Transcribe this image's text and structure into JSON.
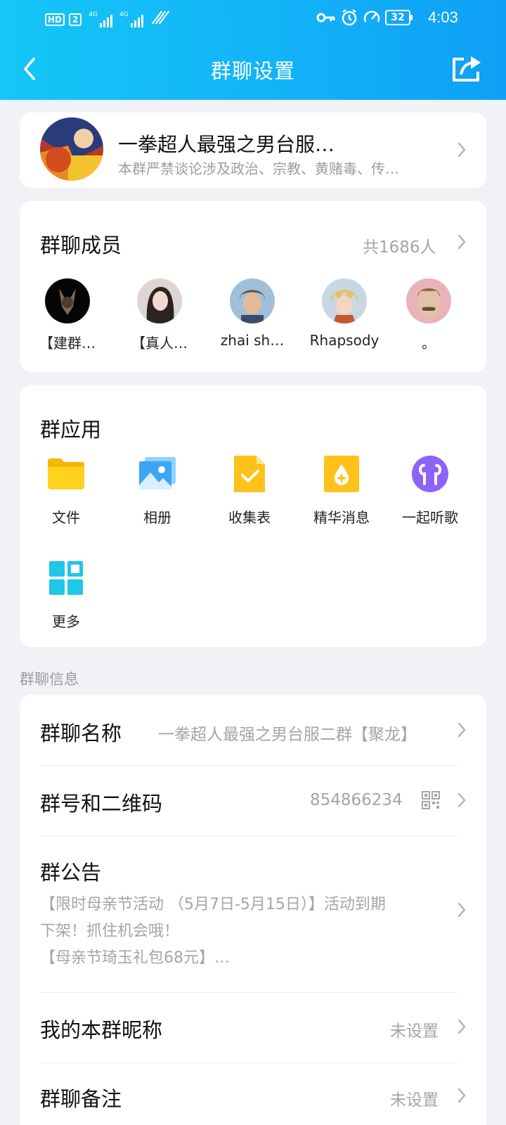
{
  "status_bar": {
    "hd_label": "HD",
    "sim_label": "2",
    "signal_label_1": "4G",
    "signal_label_2": "4G",
    "battery": "32",
    "time": "4:03"
  },
  "header": {
    "title": "群聊设置"
  },
  "group": {
    "name": "一拳超人最强之男台服…",
    "description": "本群严禁谈论涉及政治、宗教、黄赌毒、传…"
  },
  "members": {
    "title": "群聊成员",
    "count": "共1686人",
    "items": [
      {
        "name": "【建群…"
      },
      {
        "name": "【真人…"
      },
      {
        "name": "zhai sh…"
      },
      {
        "name": "Rhapsody"
      },
      {
        "name": "。"
      }
    ]
  },
  "apps": {
    "title": "群应用",
    "items": [
      {
        "label": "文件",
        "icon": "folder-icon"
      },
      {
        "label": "相册",
        "icon": "album-icon"
      },
      {
        "label": "收集表",
        "icon": "form-icon"
      },
      {
        "label": "精华消息",
        "icon": "essence-icon"
      },
      {
        "label": "一起听歌",
        "icon": "earphones-icon"
      },
      {
        "label": "更多",
        "icon": "more-apps-icon"
      }
    ]
  },
  "info": {
    "caption": "群聊信息",
    "group_name_label": "群聊名称",
    "group_name_value": "一拳超人最强之男台服二群【聚龙】",
    "group_id_label": "群号和二维码",
    "group_id_value": "854866234",
    "notice_label": "群公告",
    "notice_line1": "【限时母亲节活动 （5月7日-5月15日）】活动到期",
    "notice_line2": "下架！抓住机会哦！",
    "notice_line3": "【母亲节琦玉礼包68元】…",
    "nickname_label": "我的本群昵称",
    "nickname_value": "未设置",
    "remark_label": "群聊备注",
    "remark_value": "未设置"
  },
  "colors": {
    "header_start": "#15c6f7",
    "header_end": "#0ea0f5",
    "background": "#f1f2f6",
    "secondary_text": "#a3a5ac"
  }
}
